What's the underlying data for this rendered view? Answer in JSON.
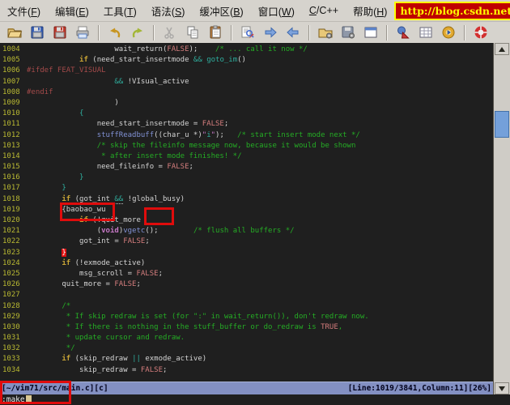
{
  "menubar": {
    "items": [
      {
        "name": "file",
        "label": "文件(F)",
        "u": 3
      },
      {
        "name": "edit",
        "label": "编辑(E)",
        "u": 3
      },
      {
        "name": "tools",
        "label": "工具(T)",
        "u": 3
      },
      {
        "name": "syntax",
        "label": "语法(S)",
        "u": 3
      },
      {
        "name": "buffers",
        "label": "缓冲区(B)",
        "u": 4
      },
      {
        "name": "window",
        "label": "窗口(W)",
        "u": 3
      },
      {
        "name": "c-cpp",
        "label": "C/C++",
        "u": 0
      },
      {
        "name": "help",
        "label": "帮助(H)",
        "u": 3
      }
    ],
    "url_banner": "http://blog.csdn.net/wooin"
  },
  "toolbar": {
    "icons": [
      "open-file-icon",
      "save-file-icon",
      "save-all-icon",
      "print-icon",
      "undo-icon",
      "redo-icon",
      "cut-icon",
      "copy-icon",
      "paste-icon",
      "find-replace-icon",
      "find-next-icon",
      "find-prev-icon",
      "load-session-icon",
      "save-session-icon",
      "new-window-icon",
      "run-ctags-icon",
      "table-icon",
      "build-tags-icon",
      "help-icon"
    ]
  },
  "editor": {
    "lines": [
      {
        "n": "1004",
        "seg": [
          [
            "n",
            "                    wait_return("
          ],
          [
            "c",
            "FALSE"
          ],
          [
            "n",
            ");    "
          ],
          [
            "m",
            "/* ... call it now */"
          ]
        ]
      },
      {
        "n": "1005",
        "seg": [
          [
            "n",
            "            "
          ],
          [
            "k",
            "if"
          ],
          [
            "n",
            " (need_start_insertmode "
          ],
          [
            "s",
            "&&"
          ],
          [
            "n",
            " "
          ],
          [
            "s",
            "goto_im"
          ],
          [
            "n",
            "()"
          ]
        ]
      },
      {
        "n": "1006",
        "seg": [
          [
            "p",
            "#ifdef FEAT_VISUAL"
          ]
        ]
      },
      {
        "n": "1007",
        "seg": [
          [
            "n",
            "                    "
          ],
          [
            "s",
            "&&"
          ],
          [
            "n",
            " !VIsual_active"
          ]
        ]
      },
      {
        "n": "1008",
        "seg": [
          [
            "p",
            "#endif"
          ]
        ]
      },
      {
        "n": "1009",
        "seg": [
          [
            "n",
            "                    )"
          ]
        ]
      },
      {
        "n": "1010",
        "seg": [
          [
            "n",
            "            "
          ],
          [
            "s",
            "{"
          ]
        ]
      },
      {
        "n": "1011",
        "seg": [
          [
            "n",
            "                need_start_insertmode = "
          ],
          [
            "c",
            "FALSE"
          ],
          [
            "n",
            ";"
          ]
        ]
      },
      {
        "n": "1012",
        "seg": [
          [
            "n",
            "                "
          ],
          [
            "f",
            "stuffReadbuff"
          ],
          [
            "n",
            "((char_u *)"
          ],
          [
            "q",
            "\""
          ],
          [
            "s",
            "i"
          ],
          [
            "q",
            "\""
          ],
          [
            "n",
            ");   "
          ],
          [
            "m",
            "/* start insert mode next */"
          ]
        ]
      },
      {
        "n": "1013",
        "seg": [
          [
            "n",
            "                "
          ],
          [
            "m",
            "/* skip the fileinfo message now, because it would be shown"
          ]
        ]
      },
      {
        "n": "1014",
        "seg": [
          [
            "n",
            "                 "
          ],
          [
            "m",
            "* after insert mode finishes! */"
          ]
        ]
      },
      {
        "n": "1015",
        "seg": [
          [
            "n",
            "                need_fileinfo = "
          ],
          [
            "c",
            "FALSE"
          ],
          [
            "n",
            ";"
          ]
        ]
      },
      {
        "n": "1016",
        "seg": [
          [
            "n",
            "            "
          ],
          [
            "s",
            "}"
          ]
        ]
      },
      {
        "n": "1017",
        "seg": [
          [
            "n",
            "        "
          ],
          [
            "s",
            "}"
          ]
        ]
      },
      {
        "n": "1018",
        "seg": [
          [
            "n",
            "        "
          ],
          [
            "uk",
            "if"
          ],
          [
            "un",
            " (got_int "
          ],
          [
            "us",
            "&&"
          ],
          [
            "n",
            " !global_busy)"
          ]
        ]
      },
      {
        "n": "1019",
        "seg": [
          [
            "n",
            "        {baobao_wu"
          ]
        ]
      },
      {
        "n": "1020",
        "seg": [
          [
            "n",
            "            "
          ],
          [
            "k",
            "if"
          ],
          [
            "n",
            " (!quit_more"
          ]
        ]
      },
      {
        "n": "1021",
        "seg": [
          [
            "n",
            "                ("
          ],
          [
            "t",
            "void"
          ],
          [
            "n",
            ")"
          ],
          [
            "f",
            "vgetc"
          ],
          [
            "n",
            "();        "
          ],
          [
            "m",
            "/* flush all buffers */"
          ]
        ]
      },
      {
        "n": "1022",
        "seg": [
          [
            "n",
            "            got_int = "
          ],
          [
            "c",
            "FALSE"
          ],
          [
            "n",
            ";"
          ]
        ]
      },
      {
        "n": "1023",
        "seg": [
          [
            "n",
            "        "
          ],
          [
            "rb",
            "}"
          ]
        ]
      },
      {
        "n": "1024",
        "seg": [
          [
            "n",
            "        "
          ],
          [
            "k",
            "if"
          ],
          [
            "n",
            " (!exmode_active)"
          ]
        ]
      },
      {
        "n": "1025",
        "seg": [
          [
            "n",
            "            msg_scroll = "
          ],
          [
            "c",
            "FALSE"
          ],
          [
            "n",
            ";"
          ]
        ]
      },
      {
        "n": "1026",
        "seg": [
          [
            "n",
            "        quit_more = "
          ],
          [
            "c",
            "FALSE"
          ],
          [
            "n",
            ";"
          ]
        ]
      },
      {
        "n": "1027",
        "seg": []
      },
      {
        "n": "1028",
        "seg": [
          [
            "n",
            "        "
          ],
          [
            "m",
            "/*"
          ]
        ]
      },
      {
        "n": "1029",
        "seg": [
          [
            "n",
            "         "
          ],
          [
            "m",
            "* If skip redraw is set (for \":\" in wait_return()), don't redraw now."
          ]
        ]
      },
      {
        "n": "1030",
        "seg": [
          [
            "n",
            "         "
          ],
          [
            "m",
            "* If there is nothing in the stuff_buffer or do_redraw is "
          ],
          [
            "c",
            "TRUE"
          ],
          [
            "m",
            ","
          ]
        ]
      },
      {
        "n": "1031",
        "seg": [
          [
            "n",
            "         "
          ],
          [
            "m",
            "* update cursor and redraw."
          ]
        ]
      },
      {
        "n": "1032",
        "seg": [
          [
            "n",
            "         "
          ],
          [
            "m",
            "*/"
          ]
        ]
      },
      {
        "n": "1033",
        "seg": [
          [
            "n",
            "        "
          ],
          [
            "k",
            "if"
          ],
          [
            "n",
            " (skip_redraw "
          ],
          [
            "s",
            "||"
          ],
          [
            "n",
            " exmode_active)"
          ]
        ]
      },
      {
        "n": "1034",
        "seg": [
          [
            "n",
            "            skip_redraw = "
          ],
          [
            "c",
            "FALSE"
          ],
          [
            "n",
            ";"
          ]
        ]
      }
    ]
  },
  "statusbar": {
    "left": "[~/vim71/src/main.c][c]",
    "right": "[Line:1019/3841,Column:11][26%]"
  },
  "cmdline": {
    "text": ":make"
  },
  "scrollbar": {
    "icons": [
      "scroll-up-icon",
      "scroll-down-icon"
    ]
  },
  "colors": {
    "code_background": "#1f1f1f",
    "line_number": "#b9b932",
    "keyword": "#c8a435",
    "comment": "#25ad25",
    "constant": "#d47d7d",
    "preproc": "#a44a4a",
    "function": "#8191d4",
    "special": "#2fae9e",
    "status_bg": "#8390c2",
    "annotation_red": "#e00c0c",
    "banner_bg": "#c00000",
    "banner_text": "#ffff00"
  }
}
